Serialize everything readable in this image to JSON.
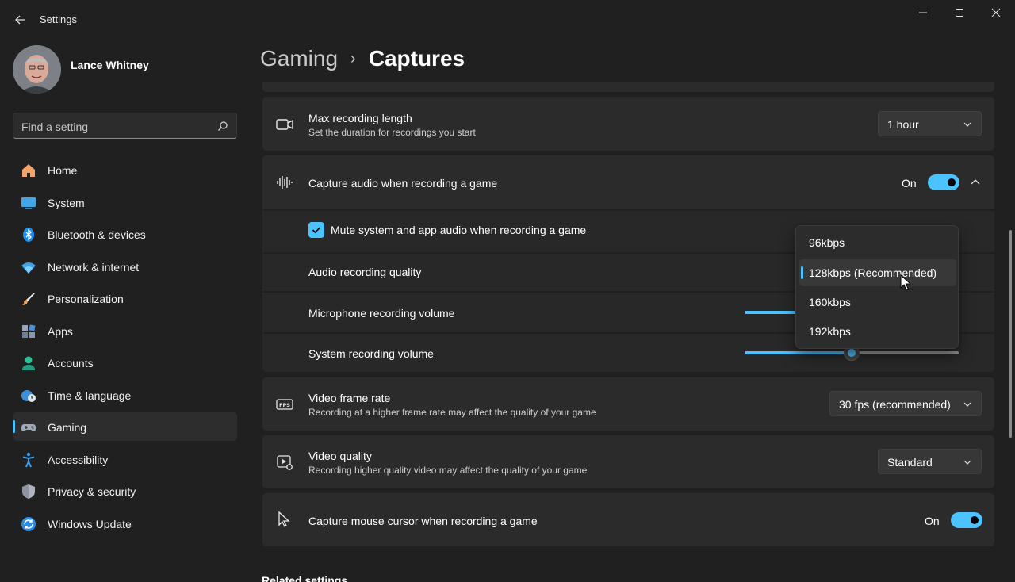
{
  "window": {
    "app_title": "Settings",
    "controls": [
      "minimize-icon",
      "maximize-icon",
      "close-icon"
    ]
  },
  "profile": {
    "name": "Lance Whitney"
  },
  "search": {
    "placeholder": "Find a setting"
  },
  "sidebar": {
    "items": [
      {
        "label": "Home",
        "icon": "home-icon"
      },
      {
        "label": "System",
        "icon": "system-icon"
      },
      {
        "label": "Bluetooth & devices",
        "icon": "bluetooth-icon"
      },
      {
        "label": "Network & internet",
        "icon": "wifi-icon"
      },
      {
        "label": "Personalization",
        "icon": "brush-icon"
      },
      {
        "label": "Apps",
        "icon": "apps-icon"
      },
      {
        "label": "Accounts",
        "icon": "accounts-icon"
      },
      {
        "label": "Time & language",
        "icon": "globe-clock-icon"
      },
      {
        "label": "Gaming",
        "icon": "gamepad-icon"
      },
      {
        "label": "Accessibility",
        "icon": "accessibility-icon"
      },
      {
        "label": "Privacy & security",
        "icon": "shield-icon"
      },
      {
        "label": "Windows Update",
        "icon": "update-icon"
      }
    ],
    "active": "Gaming"
  },
  "breadcrumb": {
    "parent": "Gaming",
    "separator": "›",
    "current": "Captures"
  },
  "settings": {
    "max_length": {
      "title": "Max recording length",
      "desc": "Set the duration for recordings you start",
      "value": "1 hour"
    },
    "capture_audio": {
      "title": "Capture audio when recording a game",
      "state": "On"
    },
    "mute_system": {
      "label": "Mute system and app audio when recording a game",
      "checked": true
    },
    "audio_quality": {
      "title": "Audio recording quality"
    },
    "mic_volume": {
      "title": "Microphone recording volume"
    },
    "system_volume": {
      "title": "System recording volume",
      "level_percent": 50
    },
    "frame_rate": {
      "title": "Video frame rate",
      "desc": "Recording at a higher frame rate may affect the quality of your game",
      "value": "30 fps (recommended)"
    },
    "video_quality": {
      "title": "Video quality",
      "desc": "Recording higher quality video may affect the quality of your game",
      "value": "Standard"
    },
    "capture_cursor": {
      "title": "Capture mouse cursor when recording a game",
      "state": "On"
    }
  },
  "audio_quality_flyout": {
    "options": [
      "96kbps",
      "128kbps (Recommended)",
      "160kbps",
      "192kbps"
    ],
    "selected": "128kbps (Recommended)"
  },
  "related": {
    "heading": "Related settings"
  },
  "colors": {
    "accent": "#4cc2ff",
    "background": "#202020",
    "card": "#2b2b2b"
  }
}
